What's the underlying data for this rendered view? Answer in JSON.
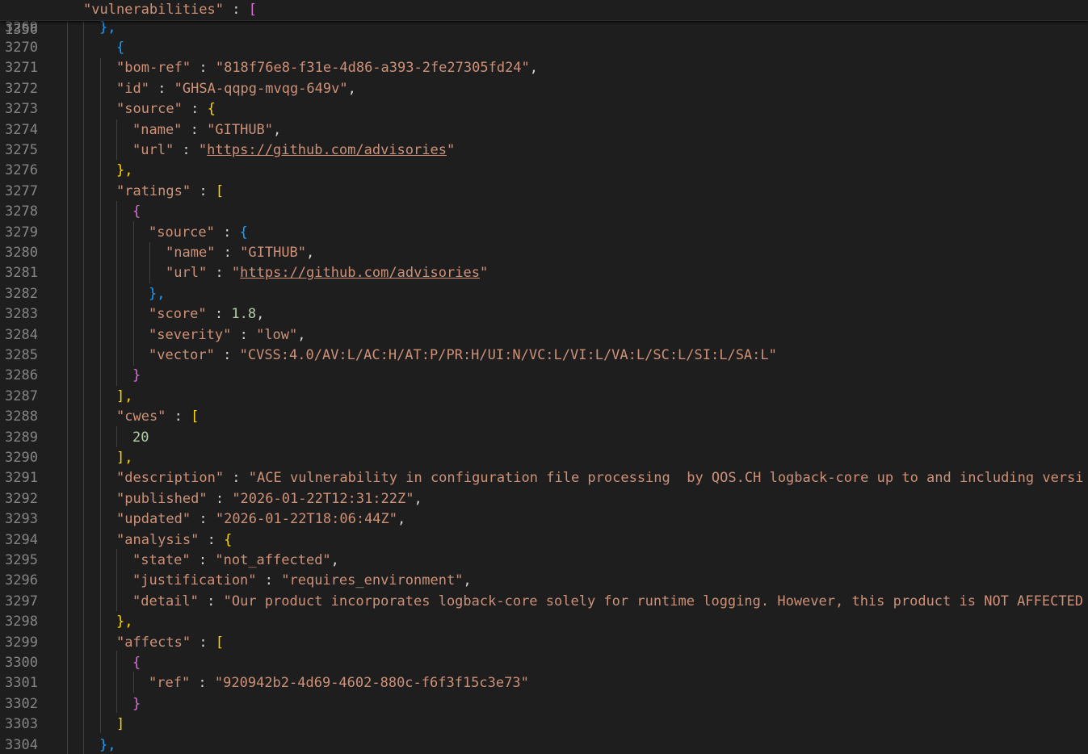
{
  "sticky": {
    "line": "1356",
    "key": "\"vulnerabilities\"",
    "sep": " : ",
    "bracket": "["
  },
  "lines": [
    {
      "n": "3269",
      "t": [
        {
          "s": "},",
          "c": "b3"
        }
      ]
    },
    {
      "n": "3270",
      "t": [
        {
          "s": "{",
          "c": "b3"
        }
      ]
    },
    {
      "n": "3271",
      "t": [
        {
          "s": "\"bom-ref\"",
          "c": "key"
        },
        {
          "s": " : ",
          "c": "punc"
        },
        {
          "s": "\"818f76e8-f31e-4d86-a393-2fe27305fd24\"",
          "c": "str"
        },
        {
          "s": ",",
          "c": "punc"
        }
      ]
    },
    {
      "n": "3272",
      "t": [
        {
          "s": "\"id\"",
          "c": "key"
        },
        {
          "s": " : ",
          "c": "punc"
        },
        {
          "s": "\"GHSA-qqpg-mvqg-649v\"",
          "c": "str"
        },
        {
          "s": ",",
          "c": "punc"
        }
      ]
    },
    {
      "n": "3273",
      "t": [
        {
          "s": "\"source\"",
          "c": "key"
        },
        {
          "s": " : ",
          "c": "punc"
        },
        {
          "s": "{",
          "c": "b1"
        }
      ]
    },
    {
      "n": "3274",
      "t": [
        {
          "s": "\"name\"",
          "c": "key"
        },
        {
          "s": " : ",
          "c": "punc"
        },
        {
          "s": "\"GITHUB\"",
          "c": "str"
        },
        {
          "s": ",",
          "c": "punc"
        }
      ]
    },
    {
      "n": "3275",
      "t": [
        {
          "s": "\"url\"",
          "c": "key"
        },
        {
          "s": " : ",
          "c": "punc"
        },
        {
          "s": "\"",
          "c": "str"
        },
        {
          "s": "https://github.com/advisories",
          "c": "str link"
        },
        {
          "s": "\"",
          "c": "str"
        }
      ]
    },
    {
      "n": "3276",
      "t": [
        {
          "s": "},",
          "c": "b1"
        }
      ]
    },
    {
      "n": "3277",
      "t": [
        {
          "s": "\"ratings\"",
          "c": "key"
        },
        {
          "s": " : ",
          "c": "punc"
        },
        {
          "s": "[",
          "c": "b1"
        }
      ]
    },
    {
      "n": "3278",
      "t": [
        {
          "s": "{",
          "c": "b2"
        }
      ]
    },
    {
      "n": "3279",
      "t": [
        {
          "s": "\"source\"",
          "c": "key"
        },
        {
          "s": " : ",
          "c": "punc"
        },
        {
          "s": "{",
          "c": "b3"
        }
      ]
    },
    {
      "n": "3280",
      "t": [
        {
          "s": "\"name\"",
          "c": "key"
        },
        {
          "s": " : ",
          "c": "punc"
        },
        {
          "s": "\"GITHUB\"",
          "c": "str"
        },
        {
          "s": ",",
          "c": "punc"
        }
      ]
    },
    {
      "n": "3281",
      "t": [
        {
          "s": "\"url\"",
          "c": "key"
        },
        {
          "s": " : ",
          "c": "punc"
        },
        {
          "s": "\"",
          "c": "str"
        },
        {
          "s": "https://github.com/advisories",
          "c": "str link"
        },
        {
          "s": "\"",
          "c": "str"
        }
      ]
    },
    {
      "n": "3282",
      "t": [
        {
          "s": "},",
          "c": "b3"
        }
      ]
    },
    {
      "n": "3283",
      "t": [
        {
          "s": "\"score\"",
          "c": "key"
        },
        {
          "s": " : ",
          "c": "punc"
        },
        {
          "s": "1.8",
          "c": "num"
        },
        {
          "s": ",",
          "c": "punc"
        }
      ]
    },
    {
      "n": "3284",
      "t": [
        {
          "s": "\"severity\"",
          "c": "key"
        },
        {
          "s": " : ",
          "c": "punc"
        },
        {
          "s": "\"low\"",
          "c": "str"
        },
        {
          "s": ",",
          "c": "punc"
        }
      ]
    },
    {
      "n": "3285",
      "t": [
        {
          "s": "\"vector\"",
          "c": "key"
        },
        {
          "s": " : ",
          "c": "punc"
        },
        {
          "s": "\"CVSS:4.0/AV:L/AC:H/AT:P/PR:H/UI:N/VC:L/VI:L/VA:L/SC:L/SI:L/SA:L\"",
          "c": "str"
        }
      ]
    },
    {
      "n": "3286",
      "t": [
        {
          "s": "}",
          "c": "b2"
        }
      ]
    },
    {
      "n": "3287",
      "t": [
        {
          "s": "],",
          "c": "b1"
        }
      ]
    },
    {
      "n": "3288",
      "t": [
        {
          "s": "\"cwes\"",
          "c": "key"
        },
        {
          "s": " : ",
          "c": "punc"
        },
        {
          "s": "[",
          "c": "b1"
        }
      ]
    },
    {
      "n": "3289",
      "t": [
        {
          "s": "20",
          "c": "num"
        }
      ]
    },
    {
      "n": "3290",
      "t": [
        {
          "s": "],",
          "c": "b1"
        }
      ]
    },
    {
      "n": "3291",
      "t": [
        {
          "s": "\"description\"",
          "c": "key"
        },
        {
          "s": " : ",
          "c": "punc"
        },
        {
          "s": "\"ACE vulnerability in configuration file processing  by QOS.CH logback-core up to and including versi",
          "c": "str"
        }
      ]
    },
    {
      "n": "3292",
      "t": [
        {
          "s": "\"published\"",
          "c": "key"
        },
        {
          "s": " : ",
          "c": "punc"
        },
        {
          "s": "\"2026-01-22T12:31:22Z\"",
          "c": "str"
        },
        {
          "s": ",",
          "c": "punc"
        }
      ]
    },
    {
      "n": "3293",
      "t": [
        {
          "s": "\"updated\"",
          "c": "key"
        },
        {
          "s": " : ",
          "c": "punc"
        },
        {
          "s": "\"2026-01-22T18:06:44Z\"",
          "c": "str"
        },
        {
          "s": ",",
          "c": "punc"
        }
      ]
    },
    {
      "n": "3294",
      "t": [
        {
          "s": "\"analysis\"",
          "c": "key"
        },
        {
          "s": " : ",
          "c": "punc"
        },
        {
          "s": "{",
          "c": "b1"
        }
      ]
    },
    {
      "n": "3295",
      "t": [
        {
          "s": "\"state\"",
          "c": "key"
        },
        {
          "s": " : ",
          "c": "punc"
        },
        {
          "s": "\"not_affected\"",
          "c": "str"
        },
        {
          "s": ",",
          "c": "punc"
        }
      ]
    },
    {
      "n": "3296",
      "t": [
        {
          "s": "\"justification\"",
          "c": "key"
        },
        {
          "s": " : ",
          "c": "punc"
        },
        {
          "s": "\"requires_environment\"",
          "c": "str"
        },
        {
          "s": ",",
          "c": "punc"
        }
      ]
    },
    {
      "n": "3297",
      "t": [
        {
          "s": "\"detail\"",
          "c": "key"
        },
        {
          "s": " : ",
          "c": "punc"
        },
        {
          "s": "\"Our product incorporates logback-core solely for runtime logging. However, this product is NOT AFFECTED",
          "c": "str"
        }
      ]
    },
    {
      "n": "3298",
      "t": [
        {
          "s": "},",
          "c": "b1"
        }
      ]
    },
    {
      "n": "3299",
      "t": [
        {
          "s": "\"affects\"",
          "c": "key"
        },
        {
          "s": " : ",
          "c": "punc"
        },
        {
          "s": "[",
          "c": "b1"
        }
      ]
    },
    {
      "n": "3300",
      "t": [
        {
          "s": "{",
          "c": "b2"
        }
      ]
    },
    {
      "n": "3301",
      "t": [
        {
          "s": "\"ref\"",
          "c": "key"
        },
        {
          "s": " : ",
          "c": "punc"
        },
        {
          "s": "\"920942b2-4d69-4602-880c-f6f3f15c3e73\"",
          "c": "str"
        }
      ]
    },
    {
      "n": "3302",
      "t": [
        {
          "s": "}",
          "c": "b2"
        }
      ]
    },
    {
      "n": "3303",
      "t": [
        {
          "s": "]",
          "c": "b1"
        }
      ]
    },
    {
      "n": "3304",
      "t": [
        {
          "s": "},",
          "c": "b3"
        }
      ]
    }
  ]
}
